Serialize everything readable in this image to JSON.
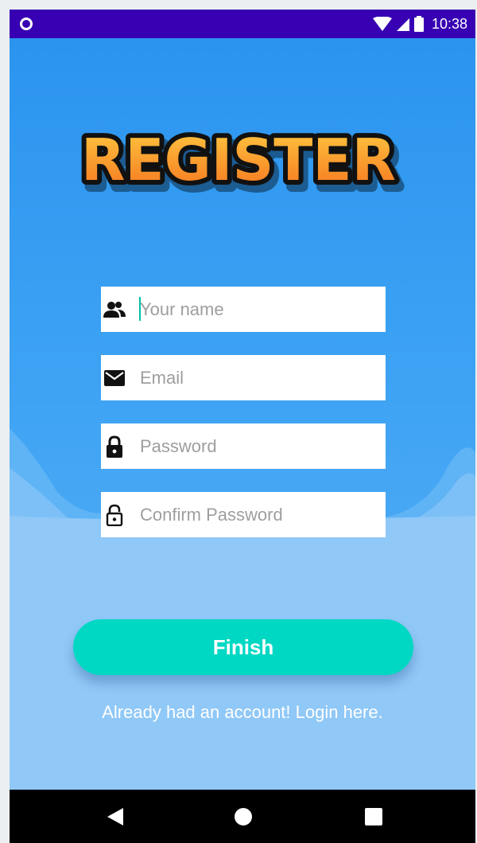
{
  "status_bar": {
    "time": "10:38",
    "background_color": "#3700b3"
  },
  "header": {
    "title": "REGISTER",
    "title_fill_top": "#ffc940",
    "title_fill_bottom": "#f5751f"
  },
  "form": {
    "name": {
      "placeholder": "Your name",
      "value": "",
      "icon": "people-icon"
    },
    "email": {
      "placeholder": "Email",
      "value": "",
      "icon": "mail-icon"
    },
    "password": {
      "placeholder": "Password",
      "value": "",
      "icon": "lock-icon"
    },
    "confirm_password": {
      "placeholder": "Confirm Password",
      "value": "",
      "icon": "lock-open-icon"
    }
  },
  "actions": {
    "finish_label": "Finish",
    "finish_color": "#00d8c4",
    "login_link": "Already had an account! Login here."
  },
  "nav_bar": {
    "icons": [
      "back-icon",
      "home-icon",
      "recents-icon"
    ]
  },
  "theme": {
    "sky_blue": "#2f97ee",
    "cloud_light": "#90c8f7"
  }
}
